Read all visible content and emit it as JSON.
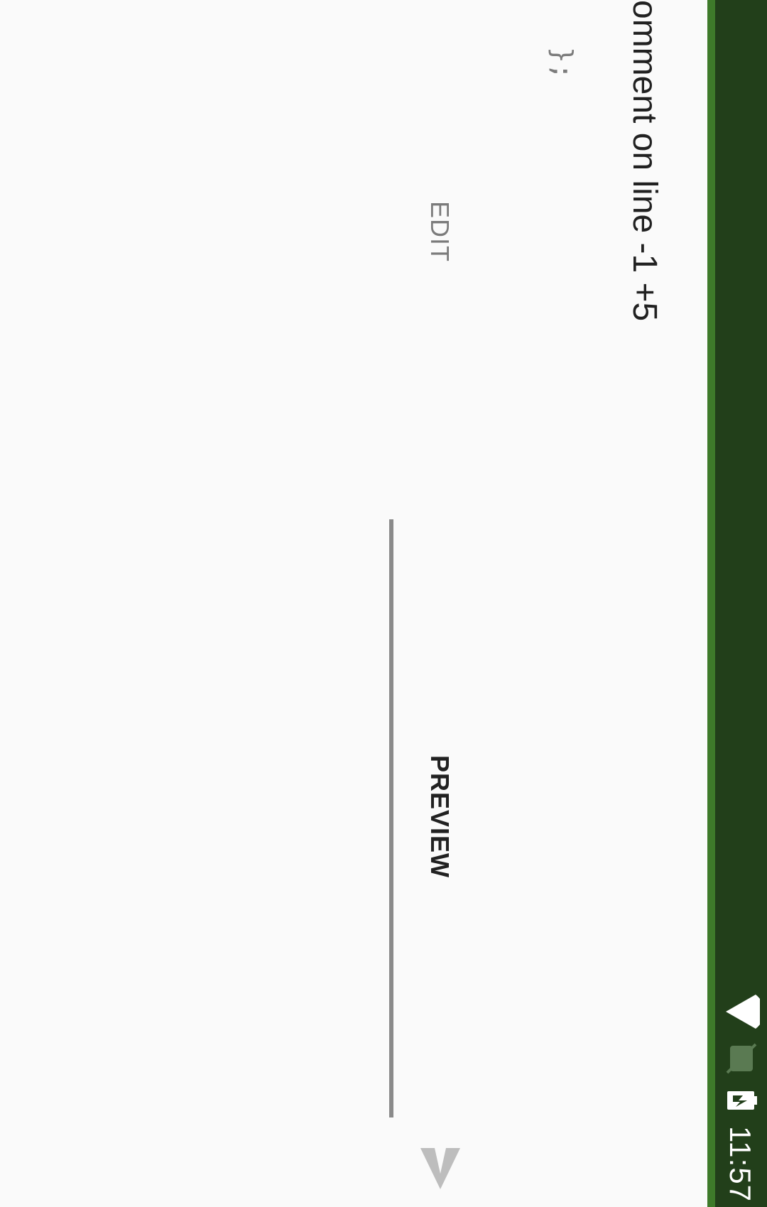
{
  "status_bar": {
    "time": "11:57",
    "icons": [
      "wifi-icon",
      "no-sim-icon",
      "battery-charging-icon"
    ]
  },
  "header": {
    "title": "omment on line -1 +5",
    "code_snippet": "};"
  },
  "tabs": [
    {
      "label": "EDIT",
      "selected": false
    },
    {
      "label": "PREVIEW",
      "selected": true
    }
  ],
  "actions": {
    "send_icon": "send-icon"
  },
  "colors": {
    "status_bar": "#223f1a",
    "app_bar_edge": "#3e7a2a",
    "background": "#fafafa",
    "primary_text": "#212121",
    "secondary_text": "#7b7b7b",
    "tab_indicator": "#8a8a8a"
  }
}
